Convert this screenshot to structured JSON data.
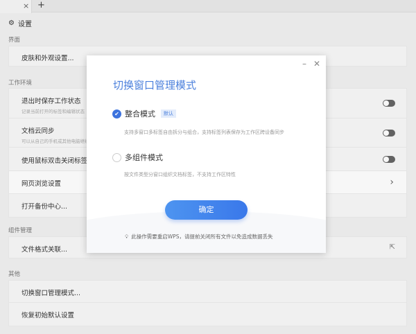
{
  "tabbar": {
    "close": "×",
    "add": "+"
  },
  "header": {
    "icon": "gear-icon",
    "title": "设置"
  },
  "sections": {
    "interface": {
      "label": "界面",
      "items": [
        "皮肤和外观设置..."
      ]
    },
    "workspace": {
      "label": "工作环境",
      "items": [
        {
          "title": "退出时保存工作状态",
          "sub": "记录当前打开的标签和编辑状态",
          "control": "toggle",
          "on": false
        },
        {
          "title": "文档云同步",
          "sub": "可以从自己的手机或其他电脑继续",
          "control": "toggle",
          "on": false
        },
        {
          "title": "使用鼠标双击关闭标签",
          "control": "toggle",
          "on": false
        },
        {
          "title": "网页浏览设置",
          "control": "chevron"
        },
        {
          "title": "打开备份中心..."
        }
      ]
    },
    "components": {
      "label": "组件管理",
      "items": [
        "文件格式关联..."
      ]
    },
    "other": {
      "label": "其他",
      "items": [
        "切换窗口管理模式...",
        "恢复初始默认设置"
      ]
    }
  },
  "dialog": {
    "title": "切换窗口管理模式",
    "option1": {
      "label": "整合模式",
      "badge": "默认",
      "desc": "支持多窗口多标签自由拆分与组合，支持标签列表保存为工作区跨设备同步",
      "selected": true
    },
    "option2": {
      "label": "多组件模式",
      "desc": "按文件类型分窗口组织文档标签，不支持工作区特性",
      "selected": false
    },
    "ok": "确定",
    "tip": "此操作需要重启WPS，请提前关闭所有文件以免造成数据丢失",
    "accent": "#3d73de"
  }
}
